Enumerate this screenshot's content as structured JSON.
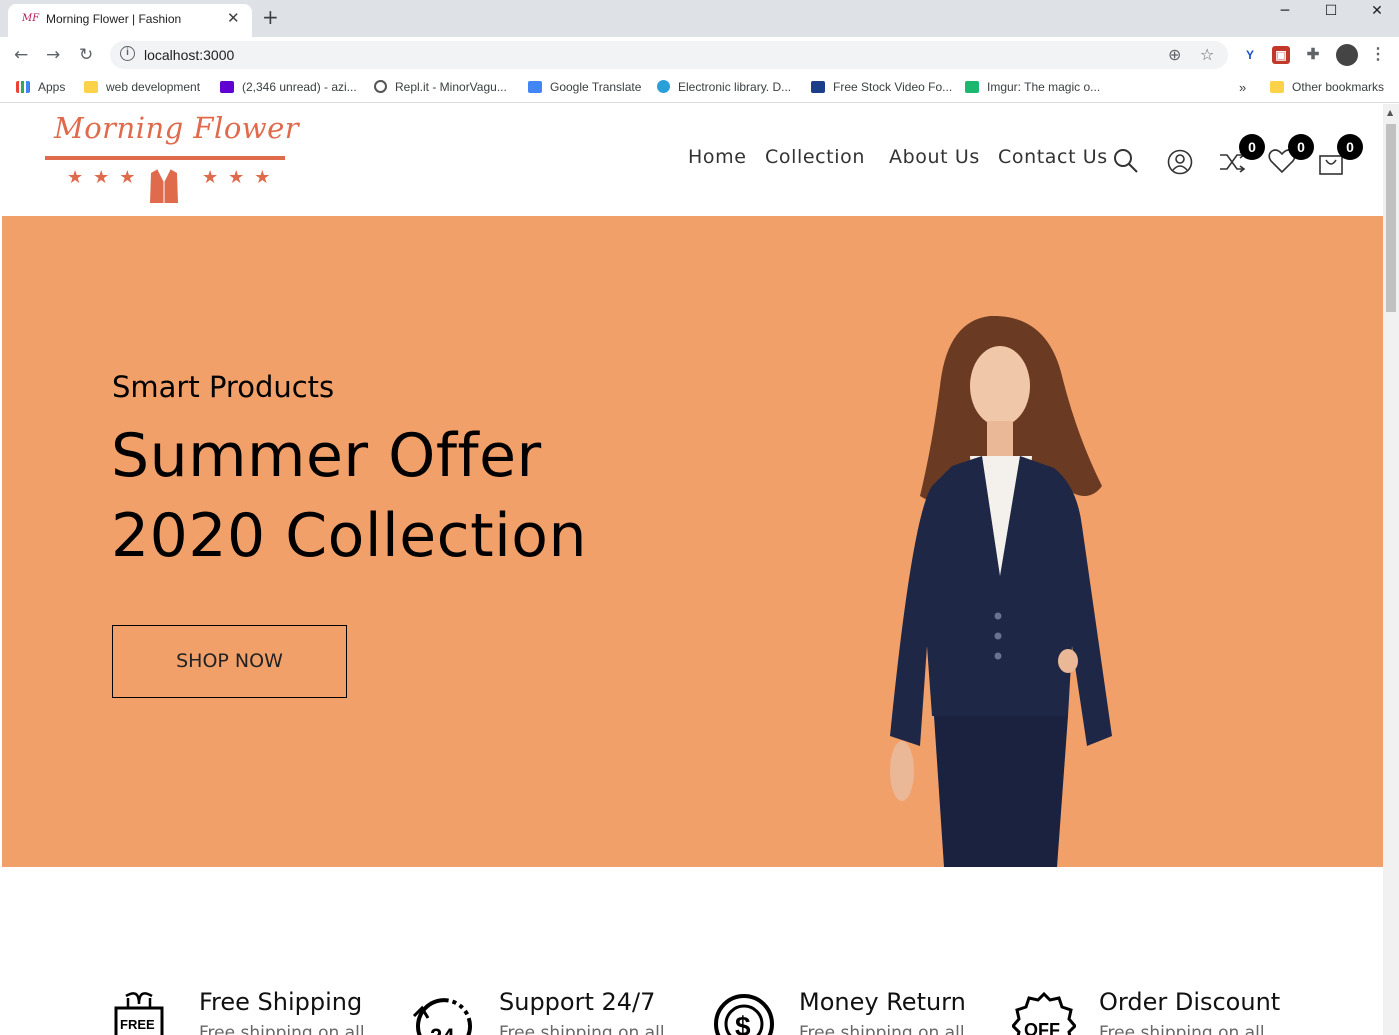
{
  "browser": {
    "tab_favicon": "MF",
    "tab_title": "Morning Flower | Fashion",
    "url": "localhost:3000",
    "bookmarks": [
      {
        "label": "Apps",
        "icon": "apps-grid-icon"
      },
      {
        "label": "web development",
        "icon": "folder-icon"
      },
      {
        "label": "(2,346 unread) - azi...",
        "icon": "mail-icon"
      },
      {
        "label": "Repl.it - MinorVagu...",
        "icon": "replit-icon"
      },
      {
        "label": "Google Translate",
        "icon": "translate-icon"
      },
      {
        "label": "Electronic library. D...",
        "icon": "globe-icon"
      },
      {
        "label": "Free Stock Video Fo...",
        "icon": "video-icon"
      },
      {
        "label": "Imgur: The magic o...",
        "icon": "imgur-icon"
      }
    ],
    "more_bookmarks": "»",
    "other_bookmarks": "Other bookmarks"
  },
  "site": {
    "logo_text": "Morning Flower",
    "logo_stars_left": "★★★",
    "logo_stars_right": "★★★",
    "nav": [
      "Home",
      "Collection",
      "About Us",
      "Contact Us"
    ],
    "compare_count": "0",
    "wishlist_count": "0",
    "cart_count": "0",
    "accent_color": "#e06a4c"
  },
  "hero": {
    "background": "#f2a06a",
    "subtitle": "Smart Products",
    "title_line1": "Summer Offer",
    "title_line2": "2020 Collection",
    "button": "SHOP NOW"
  },
  "features": [
    {
      "title": "Free Shipping",
      "desc": "Free shipping on all",
      "icon": "free-shipping-icon"
    },
    {
      "title": "Support 24/7",
      "desc": "Free shipping on all",
      "icon": "support-24-icon"
    },
    {
      "title": "Money Return",
      "desc": "Free shipping on all",
      "icon": "money-return-icon"
    },
    {
      "title": "Order Discount",
      "desc": "Free shipping on all",
      "icon": "order-discount-icon"
    }
  ]
}
